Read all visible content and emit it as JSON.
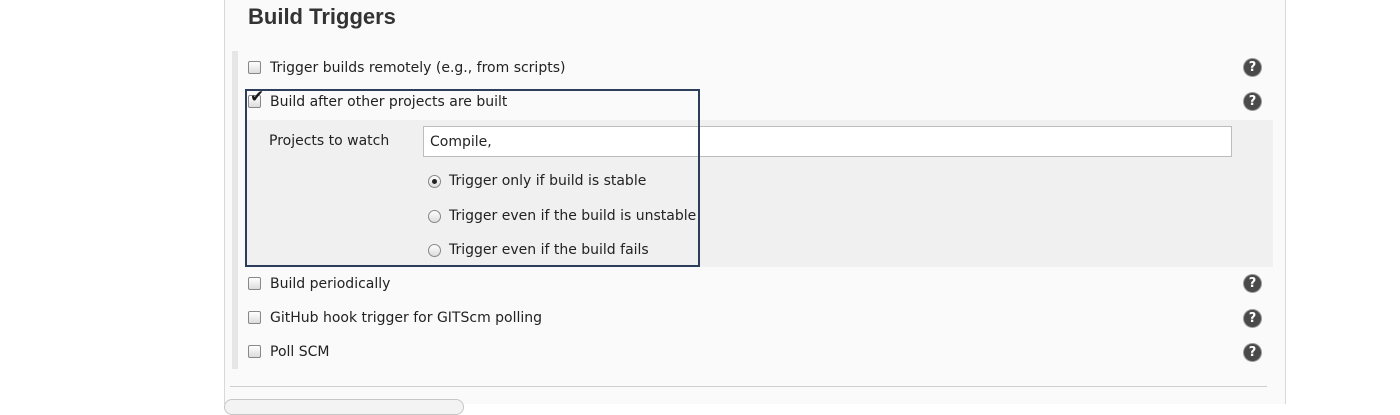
{
  "section": {
    "title": "Build Triggers"
  },
  "triggers": [
    {
      "label": "Trigger builds remotely (e.g., from scripts)",
      "checked": false
    },
    {
      "label": "Build after other projects are built",
      "checked": true
    },
    {
      "label": "Build periodically",
      "checked": false
    },
    {
      "label": "GitHub hook trigger for GITScm polling",
      "checked": false
    },
    {
      "label": "Poll SCM",
      "checked": false
    }
  ],
  "projects_to_watch": {
    "label": "Projects to watch",
    "value": "Compile,"
  },
  "radio_options": [
    {
      "label": "Trigger only if build is stable",
      "selected": true
    },
    {
      "label": "Trigger even if the build is unstable",
      "selected": false
    },
    {
      "label": "Trigger even if the build fails",
      "selected": false
    }
  ],
  "icons": {
    "help": "help-icon",
    "help_glyph": "?"
  },
  "colors": {
    "highlight_border": "#2c3e5c",
    "help_icon_bg": "#4a4a4a"
  }
}
